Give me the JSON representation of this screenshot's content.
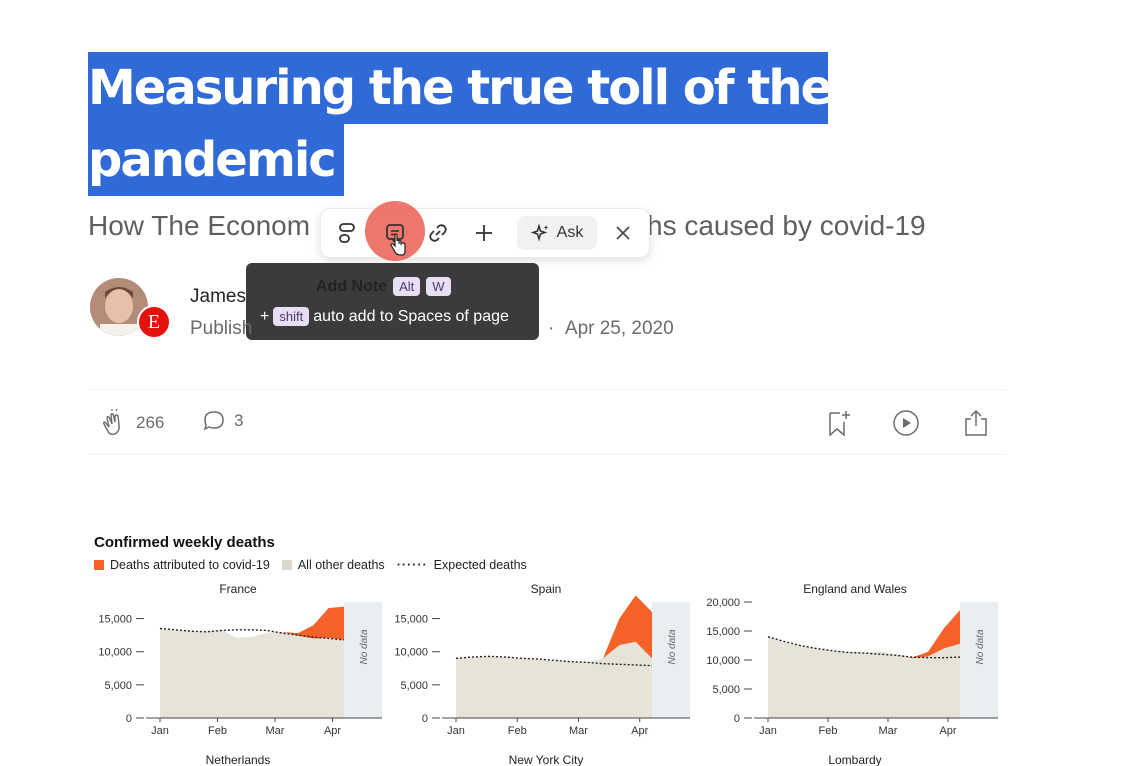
{
  "article": {
    "title_line1": "Measuring the true toll of the",
    "title_line2": "pandemic",
    "subtitle_left": "How The Econom",
    "subtitle_right": "hs caused by covid-19",
    "author_name": "James",
    "published_label": "Publish",
    "date": "Apr 25, 2020",
    "publication_badge": "E"
  },
  "toolbar": {
    "ask_label": "Ask",
    "icons": [
      "layout-icon",
      "note-icon",
      "link-icon",
      "plus-icon",
      "sparkle-icon",
      "close-icon"
    ]
  },
  "tooltip": {
    "title": "Add Note",
    "key1": "Alt",
    "key2": "W",
    "prefix": "+",
    "shift_key": "shift",
    "text": "auto add to Spaces of page"
  },
  "actions": {
    "claps": "266",
    "comments": "3"
  },
  "figure": {
    "title": "Confirmed weekly deaths",
    "legend": [
      "Deaths attributed to covid-19",
      "All other deaths",
      "Expected deaths"
    ],
    "no_data_label": "No data",
    "bottom_labels": [
      "Netherlands",
      "New York City",
      "Lombardy"
    ],
    "colors": {
      "covid": "#f4622a",
      "other": "#e6e3d8",
      "nodata": "#e9eef0"
    }
  },
  "chart_data": [
    {
      "type": "area",
      "title": "France",
      "x": [
        "Jan",
        "Feb",
        "Mar",
        "Apr"
      ],
      "yticks": [
        "15,000",
        "10,000",
        "5,000",
        "0"
      ],
      "ylim": [
        0,
        17500
      ],
      "series": [
        {
          "name": "All other deaths",
          "values": [
            13500,
            13200,
            13100,
            13000,
            13300,
            12100,
            12200,
            12900,
            13000,
            12400,
            12000,
            12100,
            11800
          ]
        },
        {
          "name": "Deaths attributed to covid-19",
          "values": [
            0,
            0,
            0,
            0,
            0,
            0,
            0,
            0,
            0,
            400,
            2000,
            4500,
            5000
          ]
        },
        {
          "name": "Expected deaths",
          "values": [
            13500,
            13300,
            13100,
            13000,
            13200,
            13300,
            13300,
            13200,
            12800,
            12500,
            12200,
            12000,
            11800
          ]
        }
      ]
    },
    {
      "type": "area",
      "title": "Spain",
      "x": [
        "Jan",
        "Feb",
        "Mar",
        "Apr"
      ],
      "yticks": [
        "15,000",
        "10,000",
        "5,000",
        "0"
      ],
      "ylim": [
        0,
        17500
      ],
      "series": [
        {
          "name": "All other deaths",
          "values": [
            9000,
            9200,
            9300,
            9200,
            9000,
            8800,
            8600,
            8500,
            8400,
            9000,
            11000,
            11500,
            9000
          ]
        },
        {
          "name": "Deaths attributed to covid-19",
          "values": [
            0,
            0,
            0,
            0,
            0,
            0,
            0,
            0,
            0,
            0,
            4000,
            7000,
            7000
          ]
        },
        {
          "name": "Expected deaths",
          "values": [
            9000,
            9200,
            9300,
            9200,
            9000,
            8900,
            8700,
            8500,
            8400,
            8200,
            8100,
            8000,
            7900
          ]
        }
      ]
    },
    {
      "type": "area",
      "title": "England and Wales",
      "x": [
        "Jan",
        "Feb",
        "Mar",
        "Apr"
      ],
      "yticks": [
        "20,000",
        "15,000",
        "10,000",
        "5,000",
        "0"
      ],
      "ylim": [
        0,
        20000
      ],
      "series": [
        {
          "name": "All other deaths",
          "values": [
            14000,
            13000,
            12500,
            12000,
            11600,
            11400,
            11300,
            11500,
            11000,
            10300,
            10600,
            12000,
            12800
          ]
        },
        {
          "name": "Deaths attributed to covid-19",
          "values": [
            0,
            0,
            0,
            0,
            0,
            0,
            0,
            0,
            0,
            100,
            800,
            3500,
            5800
          ]
        },
        {
          "name": "Expected deaths",
          "values": [
            14000,
            13200,
            12500,
            12000,
            11600,
            11300,
            11200,
            11000,
            10800,
            10500,
            10400,
            10400,
            10500
          ]
        }
      ]
    }
  ]
}
